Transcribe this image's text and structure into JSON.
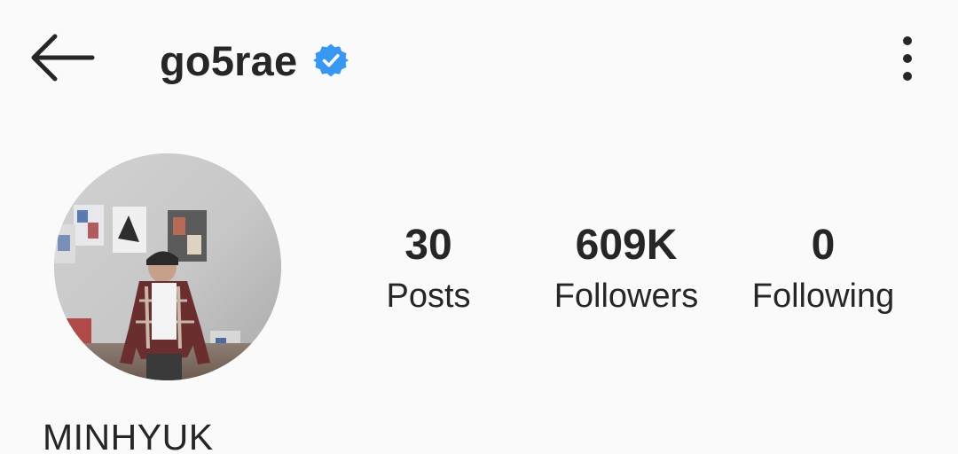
{
  "header": {
    "username": "go5rae",
    "verified": true,
    "back_icon": "arrow-left-icon",
    "verified_icon": "verified-badge-icon",
    "menu_icon": "more-vertical-icon",
    "verified_color": "#3897f0"
  },
  "profile": {
    "avatar_icon": "profile-photo",
    "display_name": "MINHYUK"
  },
  "stats": {
    "posts": {
      "count": "30",
      "label": "Posts"
    },
    "followers": {
      "count": "609K",
      "label": "Followers"
    },
    "following": {
      "count": "0",
      "label": "Following"
    }
  }
}
